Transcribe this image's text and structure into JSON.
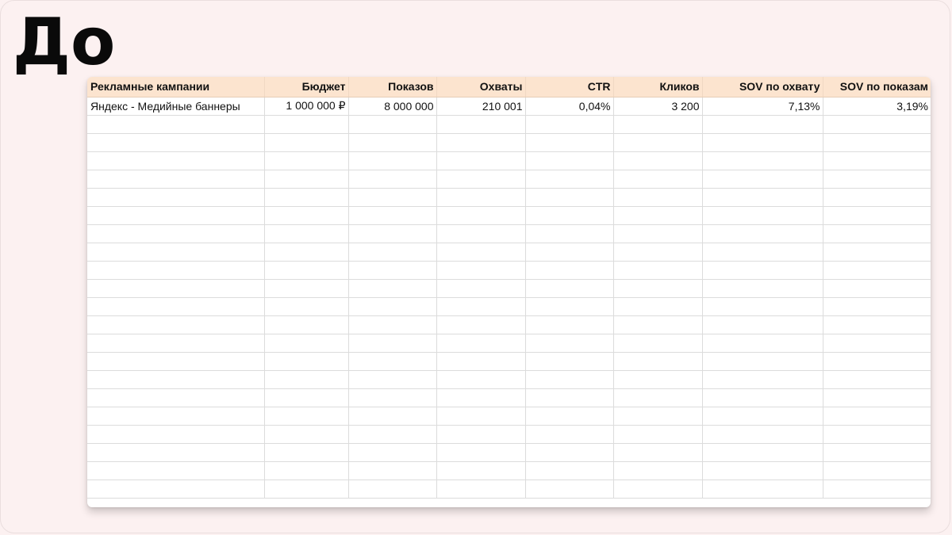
{
  "heading": "До",
  "table": {
    "columns": [
      "Рекламные кампании",
      "Бюджет",
      "Показов",
      "Охваты",
      "CTR",
      "Кликов",
      "SOV по охвату",
      "SOV по показам"
    ],
    "rows": [
      [
        "Яндекс - Медийные баннеры",
        "1 000 000 ₽",
        "8 000 000",
        "210 001",
        "0,04%",
        "3 200",
        "7,13%",
        "3,19%"
      ]
    ],
    "empty_rows": 21
  }
}
